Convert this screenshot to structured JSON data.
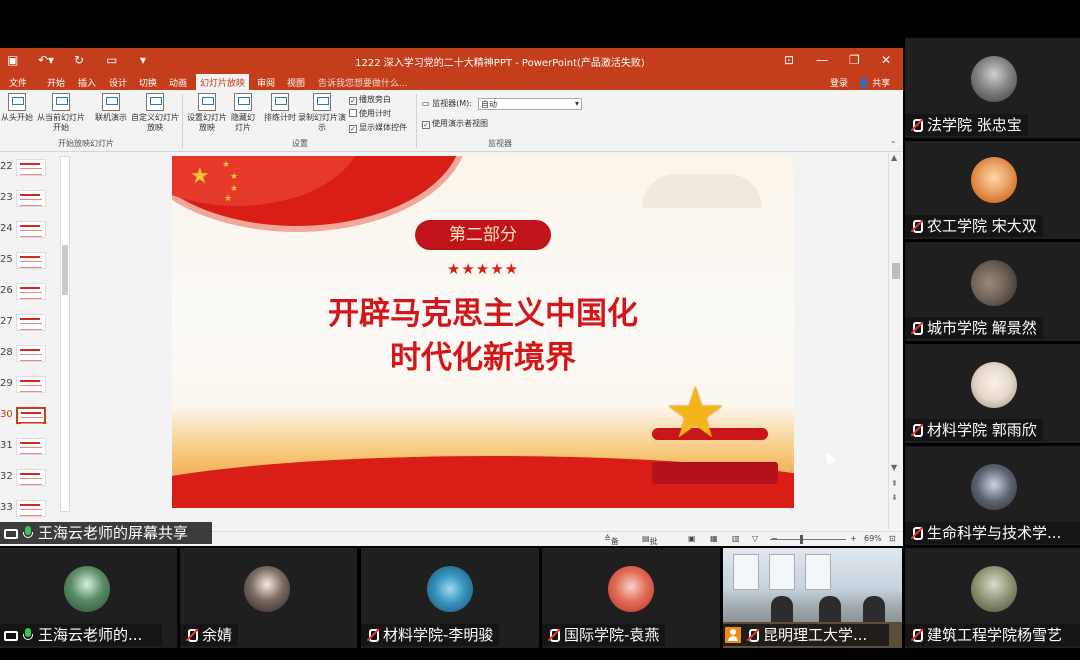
{
  "powerpoint": {
    "window_title": "1222 深入学习党的二十大精神PPT - PowerPoint(产品激活失败)",
    "menu_tabs": [
      "文件",
      "开始",
      "插入",
      "设计",
      "切换",
      "动画",
      "幻灯片放映",
      "审阅",
      "视图"
    ],
    "active_tab": "幻灯片放映",
    "tell_me": "告诉我您想要做什么...",
    "login": "登录",
    "share": "共享",
    "ribbon": {
      "from_start": "从头开始",
      "from_current": "从当前幻灯片开始",
      "online": "联机演示",
      "custom": "自定义幻灯片放映",
      "group1": "开始放映幻灯片",
      "setup": "设置幻灯片放映",
      "hide": "隐藏幻灯片",
      "rehearse": "排练计时",
      "record": "录制幻灯片演示",
      "chk_narration": "播放旁白",
      "chk_timing": "使用计时",
      "chk_media": "显示媒体控件",
      "group2": "设置",
      "monitor_label": "监视器(M):",
      "monitor_value": "自动",
      "presenter_view": "使用演示者视图",
      "group3": "监视器"
    },
    "thumbnails": [
      "22",
      "23",
      "24",
      "25",
      "26",
      "27",
      "28",
      "29",
      "30",
      "31",
      "32",
      "33"
    ],
    "active_slide": "30",
    "slide": {
      "badge": "第二部分",
      "stars": "★★★★★",
      "title_line1": "开辟马克思主义中国化",
      "title_line2": "时代化新境界"
    },
    "status": {
      "notes": "备注",
      "comments": "批注",
      "zoom": "69%"
    }
  },
  "right_panel": [
    {
      "name": "法学院 张忠宝",
      "avatar": "avatar-cat"
    },
    {
      "name": "农工学院 宋大双",
      "avatar": "avatar-cartoon"
    },
    {
      "name": "城市学院 解景然",
      "avatar": "avatar-hands"
    },
    {
      "name": "材料学院 郭雨欣",
      "avatar": "avatar-dog"
    },
    {
      "name": "生命科学与技术学...",
      "avatar": "avatar-group"
    },
    {
      "name": "建筑工程学院杨雪艺",
      "avatar": "avatar-statue"
    }
  ],
  "bottom_row": [
    {
      "name": "王海云老师的...",
      "avatar": "avatar-waterfall"
    },
    {
      "name": "余婧",
      "avatar": "avatar-anime"
    },
    {
      "name": "材料学院-李明骏",
      "avatar": "avatar-sea"
    },
    {
      "name": "国际学院-袁燕",
      "avatar": "avatar-red"
    },
    {
      "name": "昆明理工大学...",
      "avatar": "camera-feed"
    }
  ],
  "share_label": "王海云老师的屏幕共享"
}
